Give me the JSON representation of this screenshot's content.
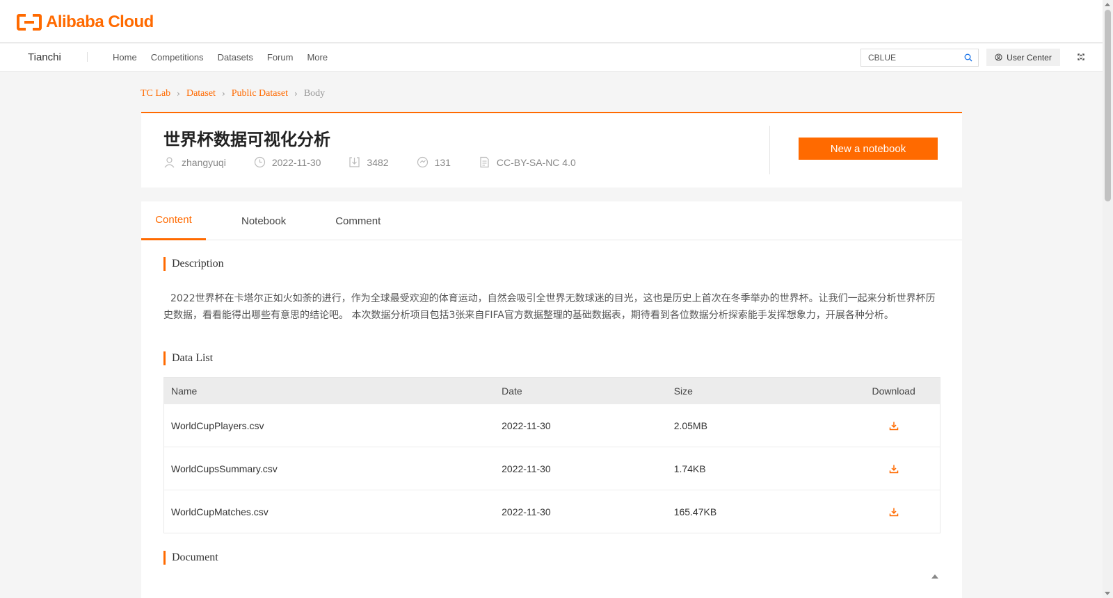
{
  "logo": {
    "text": "Alibaba Cloud"
  },
  "nav": {
    "brand": "Tianchi",
    "links": [
      "Home",
      "Competitions",
      "Datasets",
      "Forum",
      "More"
    ],
    "search_value": "CBLUE",
    "user_center": "User Center"
  },
  "breadcrumb": [
    "TC Lab",
    "Dataset",
    "Public Dataset",
    "Body"
  ],
  "header": {
    "title": "世界杯数据可视化分析",
    "author": "zhangyuqi",
    "date": "2022-11-30",
    "downloads": "3482",
    "views": "131",
    "license": "CC-BY-SA-NC 4.0",
    "new_notebook": "New a notebook"
  },
  "tabs": [
    "Content",
    "Notebook",
    "Comment"
  ],
  "sections": {
    "description_title": "Description",
    "description_text": "2022世界杯在卡塔尔正如火如荼的进行，作为全球最受欢迎的体育运动，自然会吸引全世界无数球迷的目光，这也是历史上首次在冬季举办的世界杯。让我们一起来分析世界杯历史数据，看看能得出哪些有意思的结论吧。 本次数据分析项目包括3张来自FIFA官方数据整理的基础数据表，期待看到各位数据分析探索能手发挥想象力，开展各种分析。",
    "data_list_title": "Data List",
    "document_title": "Document"
  },
  "table": {
    "headers": [
      "Name",
      "Date",
      "Size",
      "Download"
    ],
    "rows": [
      {
        "name": "WorldCupPlayers.csv",
        "date": "2022-11-30",
        "size": "2.05MB"
      },
      {
        "name": "WorldCupsSummary.csv",
        "date": "2022-11-30",
        "size": "1.74KB"
      },
      {
        "name": "WorldCupMatches.csv",
        "date": "2022-11-30",
        "size": "165.47KB"
      }
    ]
  },
  "colors": {
    "accent": "#ff6a00"
  }
}
